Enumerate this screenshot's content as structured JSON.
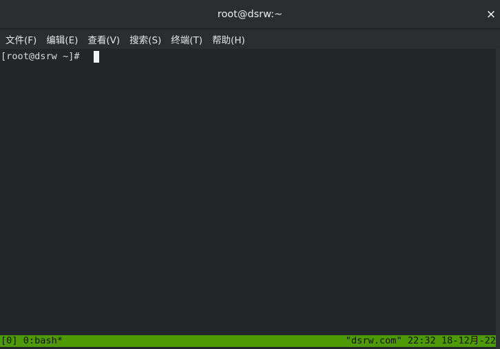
{
  "window": {
    "title": "root@dsrw:~",
    "close_label": "×"
  },
  "menubar": {
    "items": [
      {
        "label": "文件(F)"
      },
      {
        "label": "编辑(E)"
      },
      {
        "label": "查看(V)"
      },
      {
        "label": "搜索(S)"
      },
      {
        "label": "终端(T)"
      },
      {
        "label": "帮助(H)"
      }
    ]
  },
  "terminal": {
    "prompt": "[root@dsrw ~]# "
  },
  "statusbar": {
    "left": "[0] 0:bash*",
    "right": "\"dsrw.com\" 22:32 18-12月-22",
    "color": "#4e9a06"
  },
  "colors": {
    "background": "#232729",
    "chrome": "#2b2e31",
    "text": "#d9d9d9"
  }
}
